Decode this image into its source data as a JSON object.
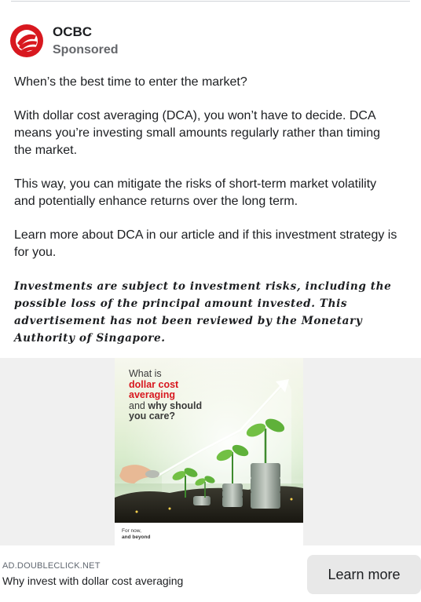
{
  "advertiser": {
    "name": "OCBC",
    "sponsored_label": "Sponsored",
    "brand_color": "#d8181f"
  },
  "post": {
    "paragraphs": [
      "When’s the best time to enter the market?",
      "With dollar cost averaging (DCA), you won’t have to decide. DCA means you’re investing small amounts regularly rather than timing the market.",
      "This way, you can mitigate the risks of short-term market volatility and potentially enhance returns over the long term.",
      "Learn more about DCA in our article and if this investment strategy is for you."
    ],
    "disclaimer": "Investments are subject to investment risks, including the possible loss of the principal amount invested. This advertisement has not been reviewed by the Monetary Authority of Singapore."
  },
  "creative": {
    "line1": "What is",
    "line2": "dollar cost",
    "line3": "averaging",
    "line4_a": "and ",
    "line4_b": "why should",
    "line5": "you care?",
    "footer_line1": "For now,",
    "footer_line2": "and beyond"
  },
  "link": {
    "domain": "AD.DOUBLECLICK.NET",
    "headline": "Why invest with dollar cost averaging",
    "cta_label": "Learn more"
  }
}
